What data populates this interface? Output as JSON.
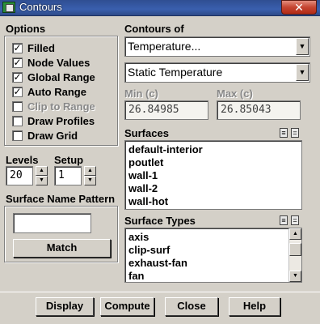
{
  "window": {
    "title": "Contours",
    "close_glyph": "✕"
  },
  "options": {
    "heading": "Options",
    "items": [
      {
        "label": "Filled",
        "checked": true,
        "enabled": true
      },
      {
        "label": "Node Values",
        "checked": true,
        "enabled": true
      },
      {
        "label": "Global Range",
        "checked": true,
        "enabled": true
      },
      {
        "label": "Auto Range",
        "checked": true,
        "enabled": true
      },
      {
        "label": "Clip to Range",
        "checked": false,
        "enabled": false
      },
      {
        "label": "Draw Profiles",
        "checked": false,
        "enabled": true
      },
      {
        "label": "Draw Grid",
        "checked": false,
        "enabled": true
      }
    ]
  },
  "levels": {
    "label": "Levels",
    "value": "20"
  },
  "setup": {
    "label": "Setup",
    "value": "1"
  },
  "surface_name_pattern": {
    "label": "Surface Name Pattern",
    "value": "",
    "match_button": "Match"
  },
  "contours_of": {
    "heading": "Contours of",
    "category": "Temperature...",
    "quantity": "Static Temperature"
  },
  "range": {
    "min_label": "Min (c)",
    "min_value": "26.84985",
    "max_label": "Max (c)",
    "max_value": "26.85043"
  },
  "surfaces": {
    "heading": "Surfaces",
    "items": [
      "default-interior",
      "poutlet",
      "wall-1",
      "wall-2",
      "wall-hot"
    ]
  },
  "surface_types": {
    "heading": "Surface Types",
    "items": [
      "axis",
      "clip-surf",
      "exhaust-fan",
      "fan"
    ]
  },
  "buttons": {
    "display": "Display",
    "compute": "Compute",
    "close": "Close",
    "help": "Help"
  },
  "glyphs": {
    "check": "✓",
    "down_arrow": "▼",
    "up_arrow": "▲",
    "select_all": "≡",
    "deselect_all": "="
  }
}
